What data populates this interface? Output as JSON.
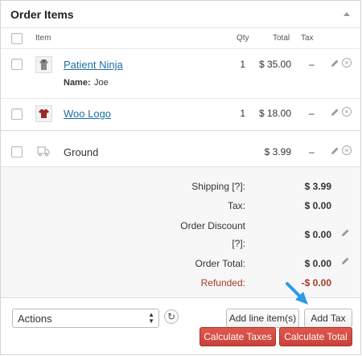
{
  "panel": {
    "title": "Order Items"
  },
  "columns": {
    "item": "Item",
    "qty": "Qty",
    "total": "Total",
    "tax": "Tax"
  },
  "items": [
    {
      "name": "Patient Ninja",
      "qty": "1",
      "total": "$ 35.00",
      "tax": "–",
      "meta_label": "Name:",
      "meta_value": "Joe",
      "thumb_icon": "hoodie-icon"
    },
    {
      "name": "Woo Logo",
      "qty": "1",
      "total": "$ 18.00",
      "tax": "–",
      "thumb_icon": "tshirt-icon"
    }
  ],
  "shipping_line": {
    "name": "Ground",
    "total": "$ 3.99",
    "tax": "–",
    "icon": "truck-icon"
  },
  "totals": {
    "shipping_label": "Shipping [?]:",
    "shipping_value": "$ 3.99",
    "tax_label": "Tax:",
    "tax_value": "$ 0.00",
    "discount_label_1": "Order Discount",
    "discount_label_2": "[?]:",
    "discount_value": "$ 0.00",
    "order_total_label": "Order Total:",
    "order_total_value": "$ 0.00",
    "refunded_label": "Refunded:",
    "refunded_value": "-$ 0.00"
  },
  "actions": {
    "selected": "Actions"
  },
  "buttons": {
    "add_line_items": "Add line item(s)",
    "add_tax": "Add Tax",
    "calculate_taxes": "Calculate Taxes",
    "calculate_total": "Calculate Total"
  },
  "colors": {
    "link": "#1e6ea7",
    "danger": "#d9534f",
    "refund": "#a33a2b",
    "arrow": "#2b9ae6"
  }
}
